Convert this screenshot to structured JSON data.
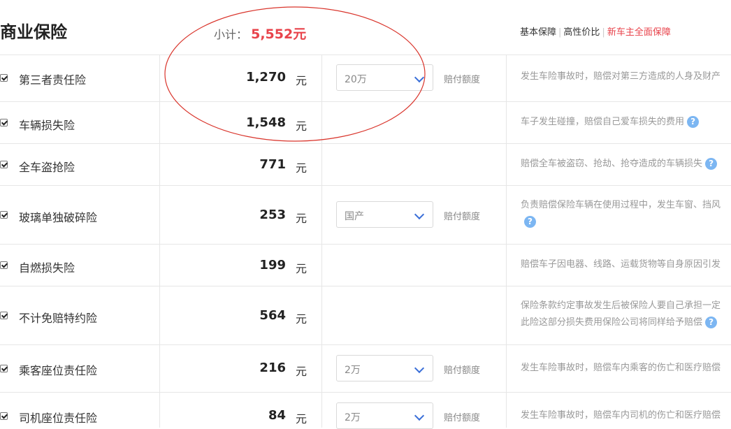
{
  "header": {
    "title": "商业保险",
    "subtotal_label": "小计：",
    "subtotal_value": "5,552元",
    "plans": [
      "基本保障",
      "高性价比",
      "新车主全面保障"
    ],
    "active_plan_color": "#e8434b"
  },
  "coverage_label": "赔付额度",
  "help_icon_glyph": "?",
  "rows": [
    {
      "name": "第三者责任险",
      "price": "1,270",
      "unit": "元",
      "select": "20万",
      "desc1": "发生车险事故时，赔偿对第三方造成的人身及财产",
      "desc2": ""
    },
    {
      "name": "车辆损失险",
      "price": "1,548",
      "unit": "元",
      "desc1": "车子发生碰撞，赔偿自己爱车损失的费用",
      "desc2": ""
    },
    {
      "name": "全车盗抢险",
      "price": "771",
      "unit": "元",
      "desc1": "赔偿全车被盗窃、抢劫、抢夺造成的车辆损失",
      "desc2": ""
    },
    {
      "name": "玻璃单独破碎险",
      "price": "253",
      "unit": "元",
      "select": "国产",
      "desc1": "负责赔偿保险车辆在使用过程中，发生车窗、挡风",
      "desc2": ""
    },
    {
      "name": "自燃损失险",
      "price": "199",
      "unit": "元",
      "desc1": "赔偿车子因电器、线路、运载货物等自身原因引发",
      "desc2": ""
    },
    {
      "name": "不计免赔特约险",
      "price": "564",
      "unit": "元",
      "desc1": "保险条款约定事故发生后被保险人要自己承担一定",
      "desc2": "此险这部分损失费用保险公司将同样给予赔偿"
    },
    {
      "name": "乘客座位责任险",
      "price": "216",
      "unit": "元",
      "select": "2万",
      "desc1": "发生车险事故时，赔偿车内乘客的伤亡和医疗赔偿",
      "desc2": ""
    },
    {
      "name": "司机座位责任险",
      "price": "84",
      "unit": "元",
      "select": "2万",
      "desc1": "发生车险事故时，赔偿车内司机的伤亡和医疗赔偿",
      "desc2": ""
    }
  ]
}
